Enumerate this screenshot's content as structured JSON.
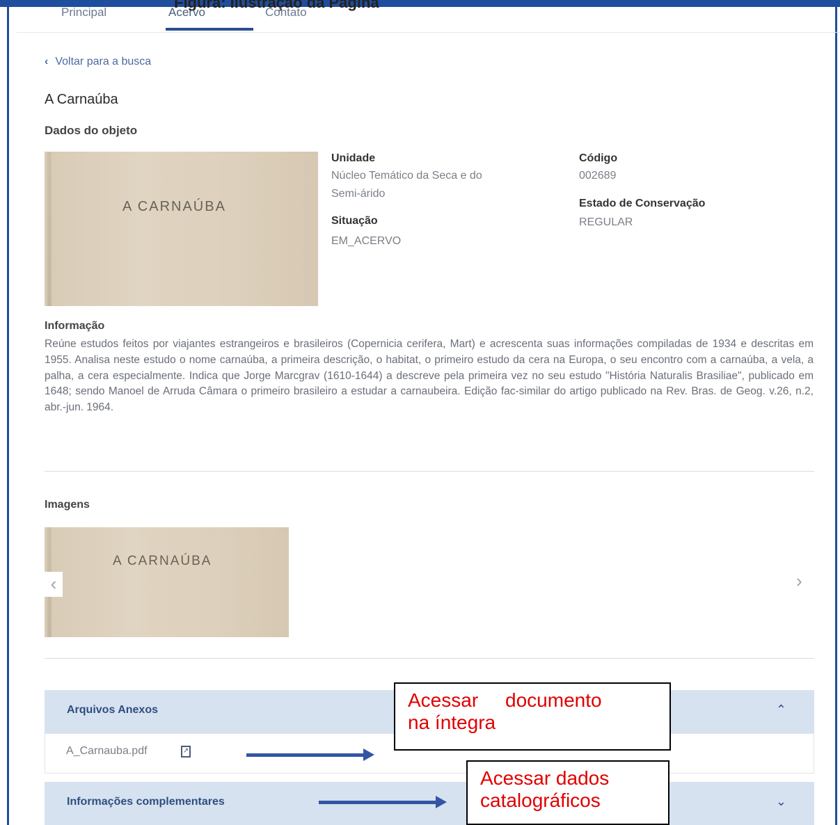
{
  "caption": "Figura: Ilustração da Página",
  "nav": {
    "tabs": [
      "Principal",
      "Acervo",
      "Contato"
    ]
  },
  "back_link": "Voltar para a busca",
  "title": "A Carnaúba",
  "object_section": "Dados do objeto",
  "thumbnail_text": "A CARNAÚBA",
  "fields": {
    "unidade_label": "Unidade",
    "unidade_value_1": "Núcleo Temático da Seca e do",
    "unidade_value_2": "Semi-árido",
    "situacao_label": "Situação",
    "situacao_value": "EM_ACERVO",
    "codigo_label": "Código",
    "codigo_value": "002689",
    "estado_label": "Estado de Conservação",
    "estado_value": "REGULAR"
  },
  "info_label": "Informação",
  "info_text": "Reúne estudos feitos por viajantes estrangeiros e brasileiros (Copernicia cerifera, Mart) e acrescenta suas informações compiladas de 1934 e descritas em 1955. Analisa neste estudo o nome carnaúba, a primeira descrição, o habitat, o primeiro estudo da cera na Europa, o seu encontro com a carnaúba, a vela, a palha, a cera especialmente. Indica que Jorge Marcgrav (1610-1644) a descreve pela primeira vez no seu estudo \"História Naturalis Brasiliae\", publicado em 1648; sendo Manoel de Arruda Câmara o primeiro brasileiro a estudar a carnaubeira. Edição fac-similar do artigo publicado na Rev. Bras. de Geog. v.26, n.2, abr.-jun. 1964.",
  "images_label": "Imagens",
  "carousel": {
    "prev_icon": "chevron-left-icon",
    "next_icon": "chevron-right-icon"
  },
  "attachments": {
    "header": "Arquivos Anexos",
    "file_name": "A_Carnauba.pdf",
    "icon": "pdf-file-icon"
  },
  "complementary": {
    "header": "Informações complementares"
  },
  "annotations": {
    "box1_line1": "Acessar     documento",
    "box1_line2": "na íntegra",
    "box2_line1": "Acessar dados",
    "box2_line2": "catalográficos"
  },
  "colors": {
    "accent": "#1f4e9e",
    "accordion_bg": "#d7e2f1",
    "annotation_text": "#e00000"
  }
}
